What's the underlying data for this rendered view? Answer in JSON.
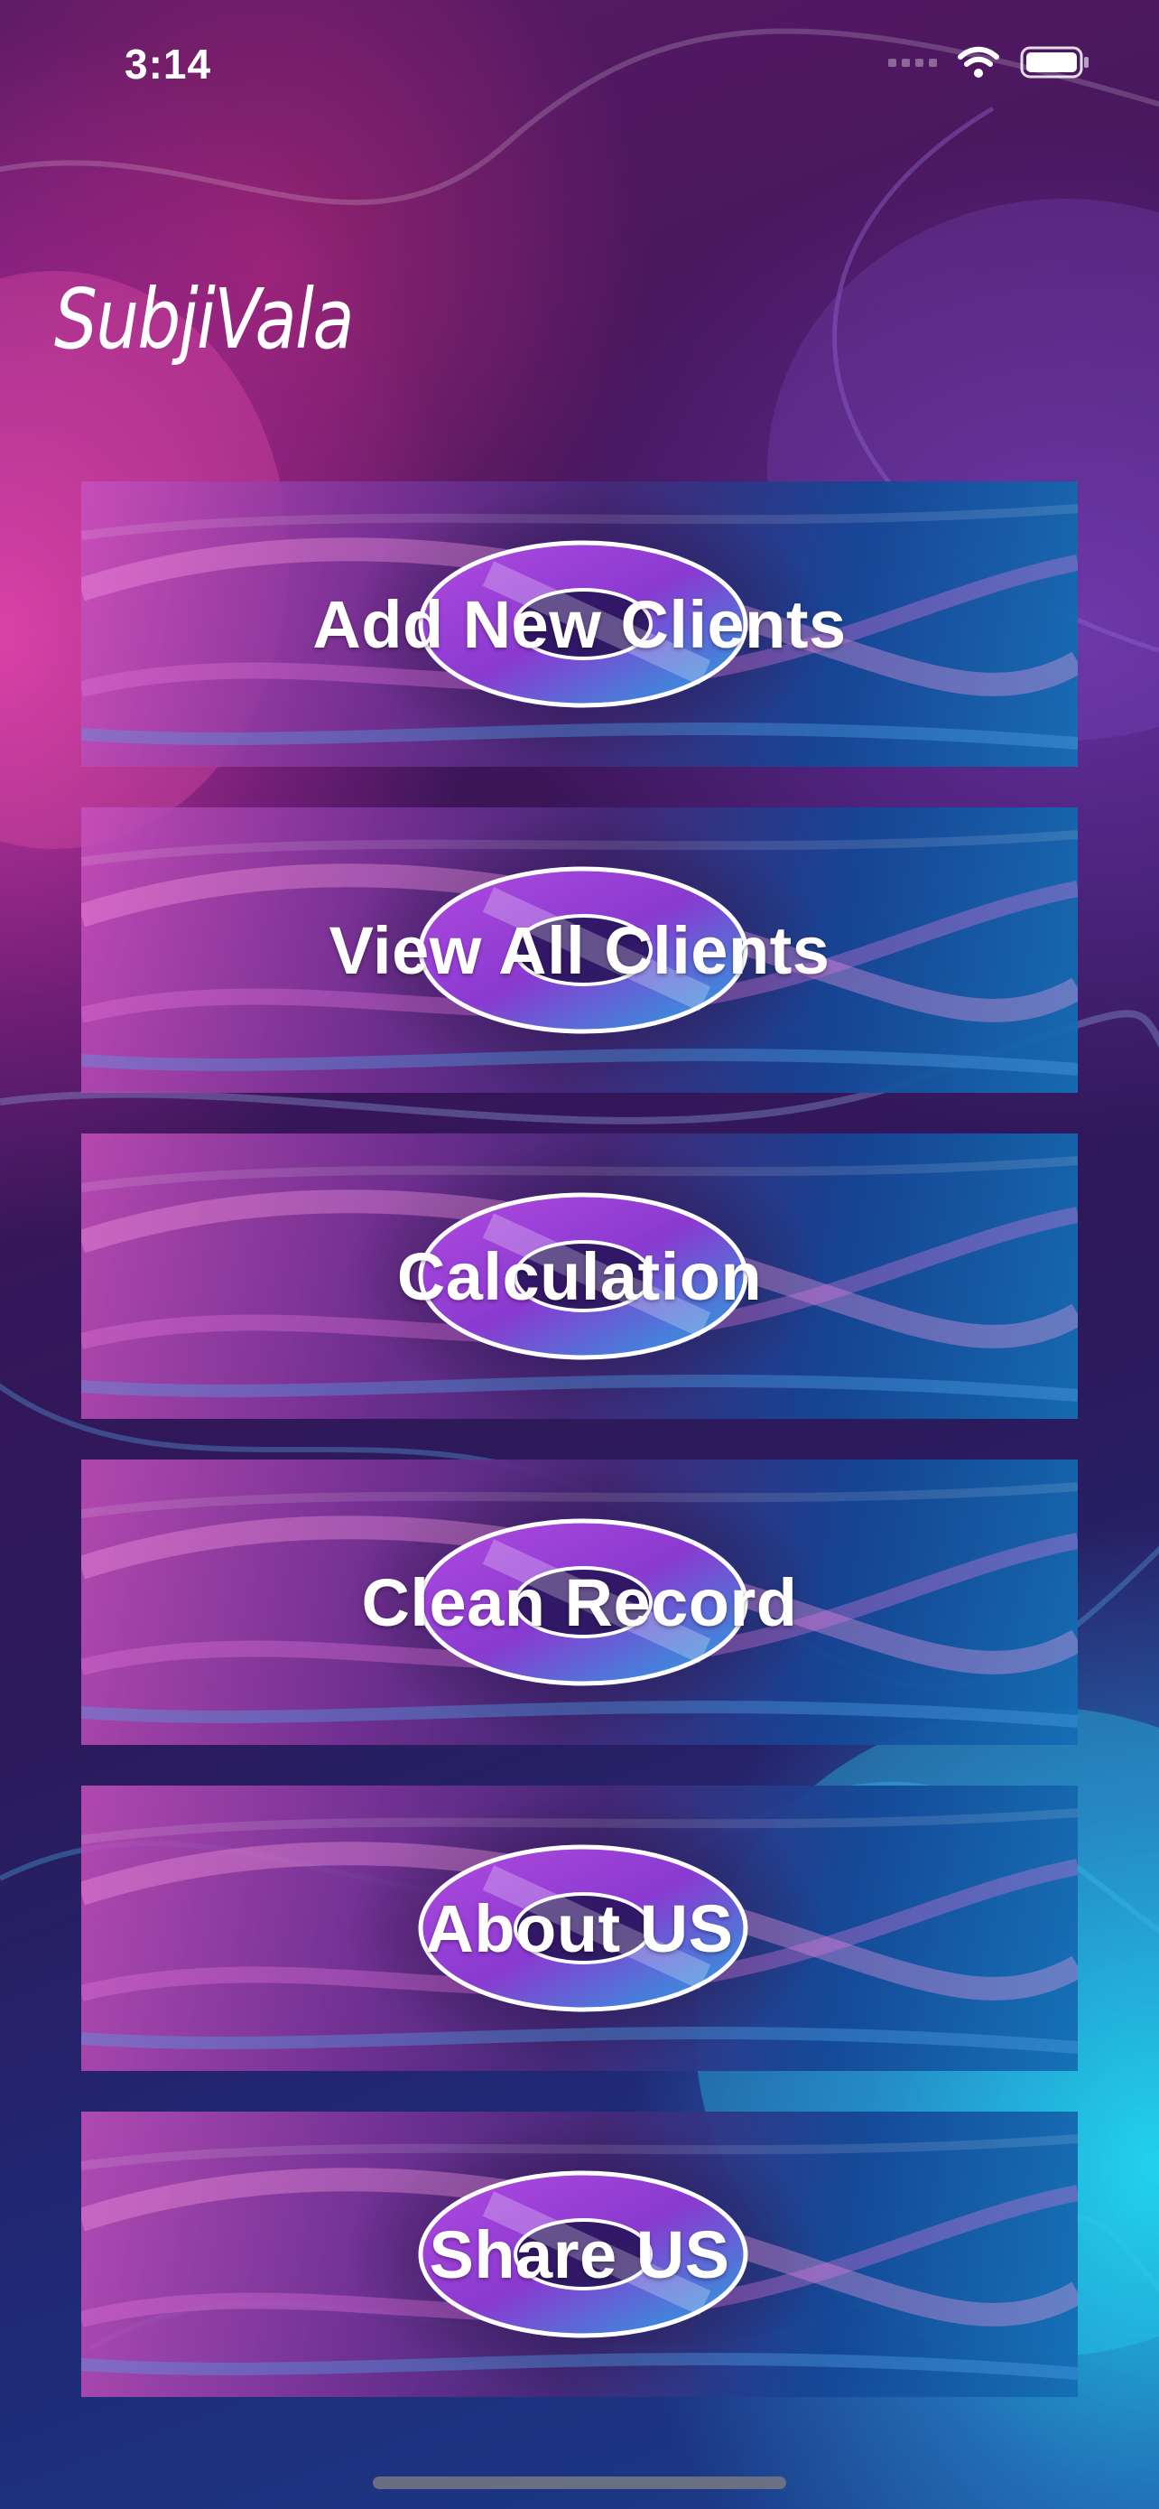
{
  "status_bar": {
    "time": "3:14",
    "icons": [
      "signal-icon",
      "wifi-icon",
      "battery-icon"
    ]
  },
  "app": {
    "title": "SubjiVala"
  },
  "menu": {
    "items": [
      {
        "label": "Add New Clients"
      },
      {
        "label": "View All Clients"
      },
      {
        "label": "Calculation"
      },
      {
        "label": "Clean Record"
      },
      {
        "label": "About US"
      },
      {
        "label": "Share US"
      }
    ]
  },
  "colors": {
    "text": "#ffffff",
    "background_primary": "#3a1558",
    "accent_pink": "#d03c9a",
    "accent_cyan": "#1edcf0"
  }
}
